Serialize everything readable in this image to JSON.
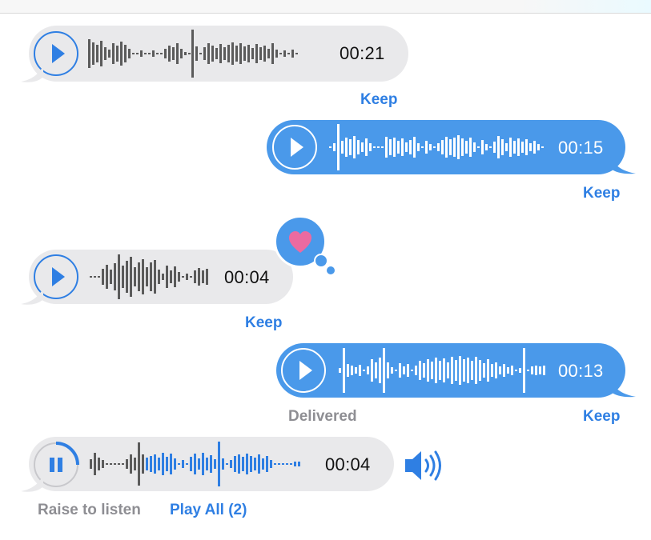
{
  "messages": [
    {
      "direction": "incoming",
      "duration": "00:21",
      "action": "Keep"
    },
    {
      "direction": "outgoing",
      "duration": "00:15",
      "action": "Keep"
    },
    {
      "direction": "incoming",
      "duration": "00:04",
      "action": "Keep",
      "reaction": "heart-icon"
    },
    {
      "direction": "outgoing",
      "duration": "00:13",
      "action": "Keep",
      "status": "Delivered"
    },
    {
      "direction": "incoming",
      "duration": "00:04",
      "state": "playing",
      "progress": 0.3
    }
  ],
  "footer": {
    "hint": "Raise to listen",
    "play_all": "Play All (2)"
  },
  "colors": {
    "accent": "#2f7fe3",
    "outgoing_bubble": "#4a99ea",
    "incoming_bubble": "#e9e9eb",
    "waveform_dark": "#555555",
    "reaction_heart": "#ec6aa0",
    "muted_text": "#8e8e93"
  }
}
